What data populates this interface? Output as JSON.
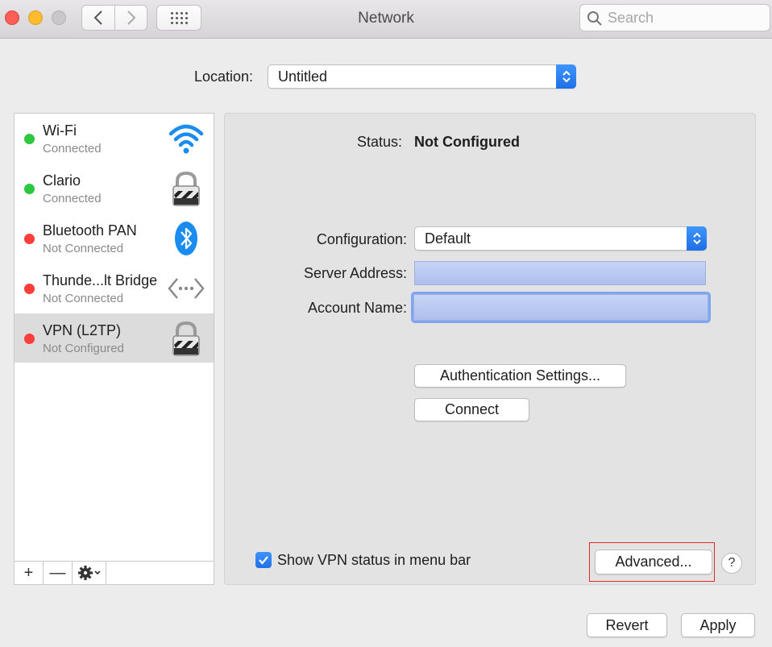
{
  "window": {
    "title": "Network"
  },
  "search": {
    "placeholder": "Search"
  },
  "location": {
    "label": "Location:",
    "value": "Untitled"
  },
  "services": [
    {
      "name": "Wi-Fi",
      "status": "Connected",
      "status_color": "green",
      "icon": "wifi-icon"
    },
    {
      "name": "Clario",
      "status": "Connected",
      "status_color": "green",
      "icon": "vpn-lock-icon"
    },
    {
      "name": "Bluetooth PAN",
      "status": "Not Connected",
      "status_color": "red",
      "icon": "bluetooth-icon"
    },
    {
      "name": "Thunde...lt Bridge",
      "status": "Not Connected",
      "status_color": "red",
      "icon": "thunderbolt-bridge-icon"
    },
    {
      "name": "VPN (L2TP)",
      "status": "Not Configured",
      "status_color": "red",
      "icon": "vpn-lock-icon",
      "selected": true
    }
  ],
  "sidebar_tools": {
    "add": "+",
    "remove": "—"
  },
  "detail": {
    "status_label": "Status:",
    "status_value": "Not Configured",
    "configuration_label": "Configuration:",
    "configuration_value": "Default",
    "server_address_label": "Server Address:",
    "server_address_value": "",
    "account_name_label": "Account Name:",
    "account_name_value": "",
    "auth_settings_button": "Authentication Settings...",
    "connect_button": "Connect",
    "show_vpn_status_label": "Show VPN status in menu bar",
    "show_vpn_status_checked": true,
    "advanced_button": "Advanced...",
    "help_button": "?"
  },
  "footer": {
    "revert_button": "Revert",
    "apply_button": "Apply"
  },
  "colors": {
    "accent": "#1f6fe6",
    "status_green": "#2bc840",
    "status_red": "#fc3d39",
    "highlight_box": "#e3262c"
  }
}
